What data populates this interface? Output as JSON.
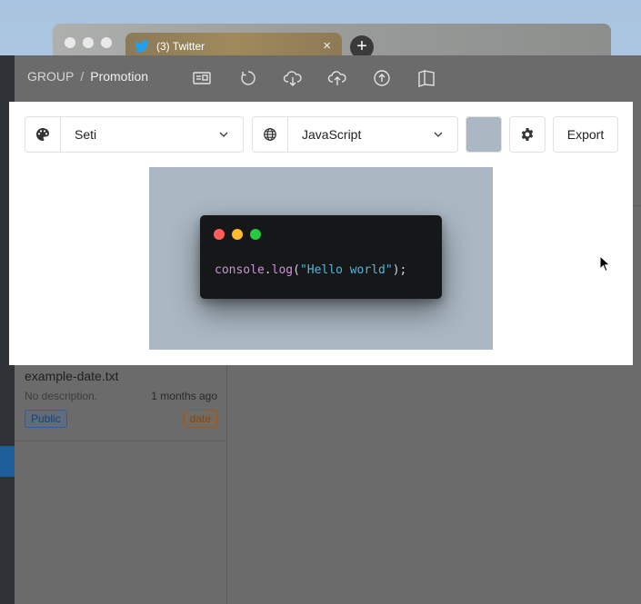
{
  "browser": {
    "tab_title": "(3) Twitter",
    "tab_close": "×",
    "new_tab": "+"
  },
  "app": {
    "breadcrumb": {
      "group": "GROUP",
      "separator": "/",
      "current": "Promotion"
    },
    "toolbar_icons": [
      "reader-icon",
      "circle-icon",
      "cloud-download-icon",
      "cloud-upload-icon",
      "arrow-up-circle-icon",
      "book-icon"
    ],
    "list": [
      {
        "name": "example-date.txt",
        "description": "No description.",
        "time": "1 months ago",
        "visibility": "Public",
        "tag": "date"
      }
    ]
  },
  "modal": {
    "theme": {
      "icon": "palette-icon",
      "value": "Seti"
    },
    "language": {
      "icon": "globe-icon",
      "value": "JavaScript"
    },
    "background_color": "#abb8c3",
    "settings_icon": "gear-icon",
    "export_label": "Export",
    "preview": {
      "window_dots": [
        "#ff5f56",
        "#ffbd2e",
        "#27c93f"
      ],
      "code": {
        "object": "console",
        "dot": ".",
        "method": "log",
        "open": "(",
        "string": "\"Hello world\"",
        "close": ");"
      }
    }
  }
}
